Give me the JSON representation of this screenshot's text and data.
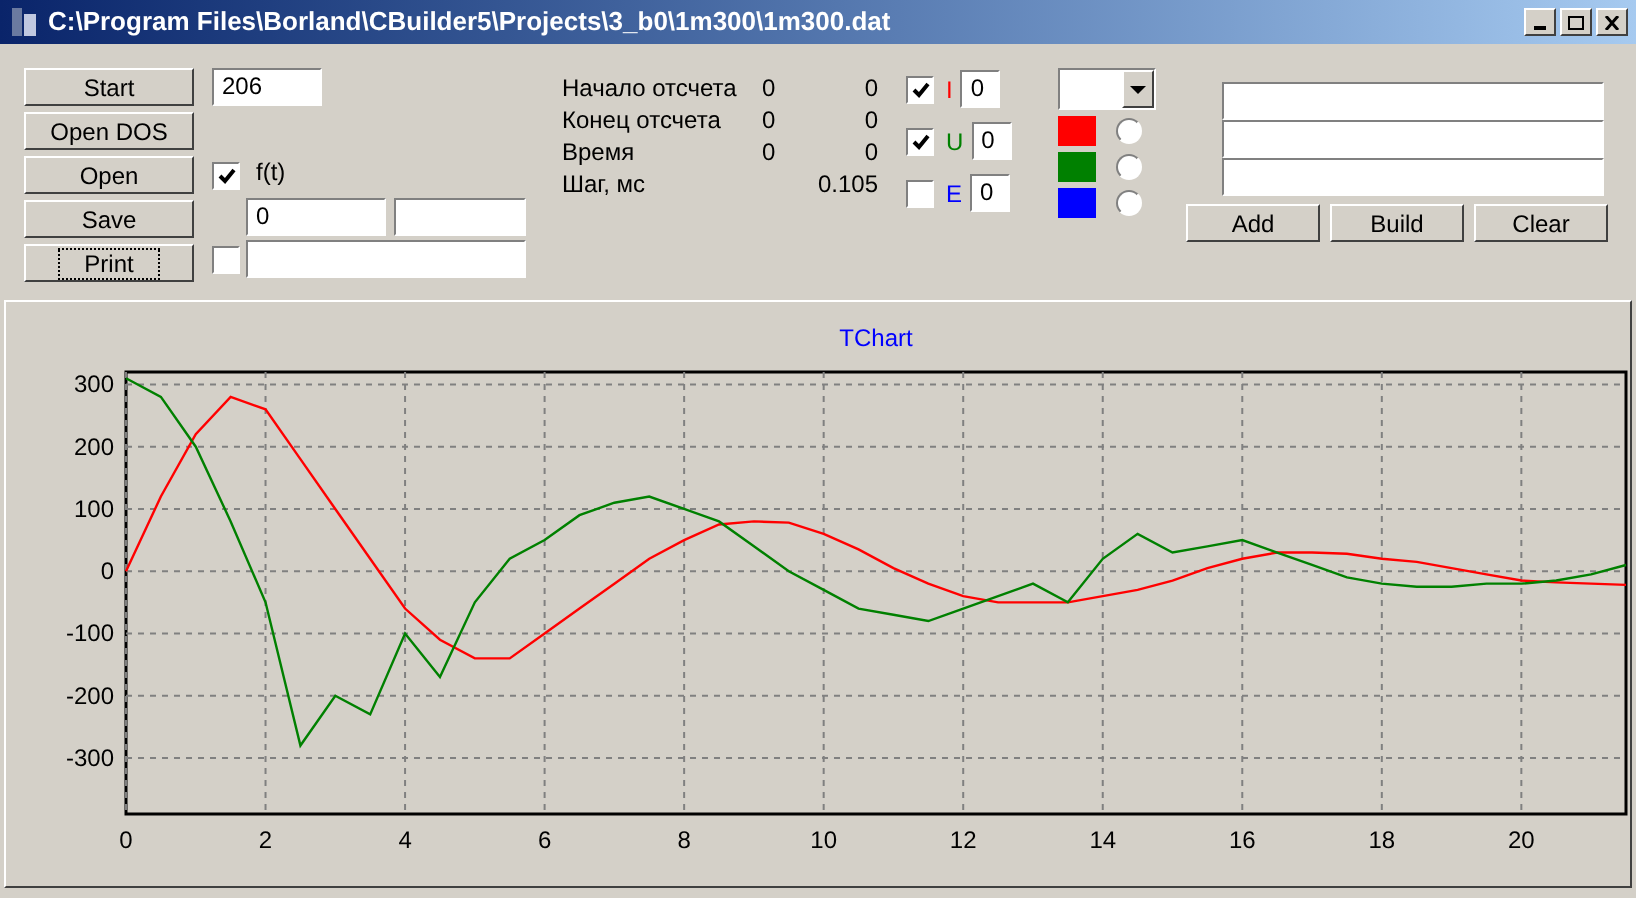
{
  "window": {
    "title": "C:\\Program Files\\Borland\\CBuilder5\\Projects\\3_b0\\1m300\\1m300.dat"
  },
  "buttons": [
    {
      "label": "Start",
      "focused": false
    },
    {
      "label": "Open DOS",
      "focused": false
    },
    {
      "label": "Open",
      "focused": false
    },
    {
      "label": "Save",
      "focused": false
    },
    {
      "label": "Print",
      "focused": true
    }
  ],
  "count_field": {
    "value": "206"
  },
  "ft_checkbox": {
    "label": "f(t)",
    "checked": true
  },
  "range_fields": [
    {
      "value": "0"
    }
  ],
  "extra_checkbox": {
    "checked": false
  },
  "readouts": [
    {
      "label": "Начало отсчета",
      "value_1": "0",
      "value_2": "0"
    },
    {
      "label": "Конец отсчета",
      "value_1": "0",
      "value_2": "0"
    },
    {
      "label": "Время",
      "value_1": "0",
      "value_2": "0"
    },
    {
      "label": "Шаг, мс",
      "value_2": "0.105"
    }
  ],
  "channels": [
    {
      "letter": "I",
      "checked": true,
      "color": "#ff0000",
      "value": "0"
    },
    {
      "letter": "U",
      "checked": true,
      "color": "#008000",
      "value": "0"
    },
    {
      "letter": "E",
      "checked": false,
      "color": "#0000ff",
      "value": "0"
    }
  ],
  "swatches": [
    {
      "color": "#ff0000",
      "selected": false
    },
    {
      "color": "#008000",
      "selected": false
    },
    {
      "color": "#0000ff",
      "selected": false
    }
  ],
  "action_buttons": [
    "Add",
    "Build",
    "Clear"
  ],
  "chart": {
    "chart_data": {
      "type": "line",
      "title": "TChart",
      "x": [
        0,
        0.5,
        1,
        1.5,
        2,
        2.5,
        3,
        3.5,
        4,
        4.5,
        5,
        5.5,
        6,
        6.5,
        7,
        7.5,
        8,
        8.5,
        9,
        9.5,
        10,
        10.5,
        11,
        11.5,
        12,
        12.5,
        13,
        13.5,
        14,
        14.5,
        15,
        15.5,
        16,
        16.5,
        17,
        17.5,
        18,
        18.5,
        19,
        19.5,
        20,
        20.5,
        21,
        21.5
      ],
      "series": [
        {
          "color": "#ff0000",
          "values": [
            0,
            120,
            220,
            280,
            260,
            180,
            100,
            20,
            -60,
            -110,
            -140,
            -140,
            -100,
            -60,
            -20,
            20,
            50,
            75,
            80,
            78,
            60,
            35,
            5,
            -20,
            -40,
            -50,
            -50,
            -50,
            -40,
            -30,
            -15,
            5,
            20,
            30,
            30,
            28,
            20,
            15,
            5,
            -5,
            -15,
            -18,
            -20,
            -22
          ]
        },
        {
          "color": "#008000",
          "values": [
            310,
            280,
            200,
            80,
            -50,
            -280,
            -200,
            -230,
            -100,
            -170,
            -50,
            20,
            50,
            90,
            110,
            120,
            100,
            80,
            40,
            0,
            -30,
            -60,
            -70,
            -80,
            -60,
            -40,
            -20,
            -50,
            20,
            60,
            30,
            40,
            50,
            30,
            10,
            -10,
            -20,
            -25,
            -25,
            -20,
            -20,
            -15,
            -5,
            10
          ]
        }
      ],
      "grid": true,
      "xlim": [
        0,
        21.5
      ],
      "ylim": [
        -390,
        320
      ],
      "xticks": [
        0,
        2,
        4,
        6,
        8,
        10,
        12,
        14,
        16,
        18,
        20
      ],
      "yticks": [
        -300,
        -200,
        -100,
        0,
        100,
        200,
        300
      ]
    }
  }
}
